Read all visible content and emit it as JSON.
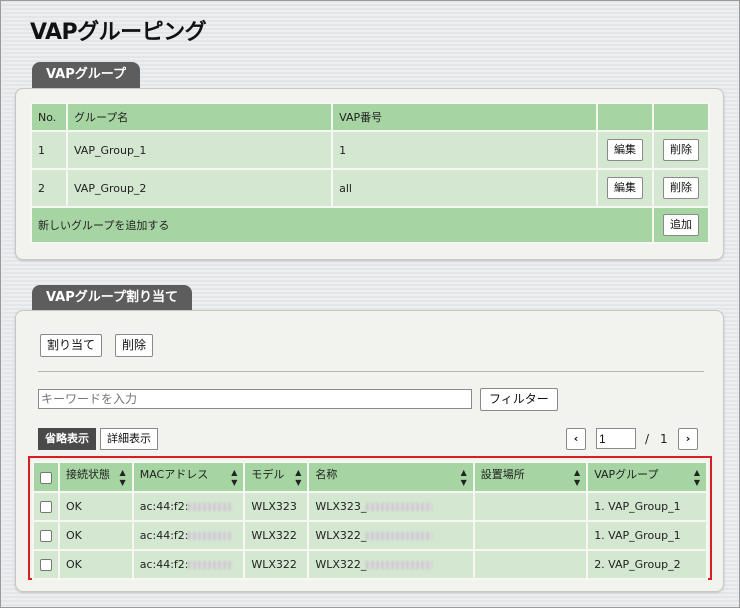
{
  "page": {
    "title": "VAPグルーピング"
  },
  "groups_section": {
    "tab_label": "VAPグループ",
    "headers": [
      "No.",
      "グループ名",
      "VAP番号"
    ],
    "rows": [
      {
        "no": "1",
        "name": "VAP_Group_1",
        "vap": "1",
        "edit_label": "編集",
        "delete_label": "削除"
      },
      {
        "no": "2",
        "name": "VAP_Group_2",
        "vap": "all",
        "edit_label": "編集",
        "delete_label": "削除"
      }
    ],
    "add_row_label": "新しいグループを追加する",
    "add_button": "追加"
  },
  "assign_section": {
    "tab_label": "VAPグループ割り当て",
    "assign_button": "割り当て",
    "delete_button": "削除",
    "keyword_placeholder": "キーワードを入力",
    "filter_button": "フィルター",
    "view_tabs": {
      "simple": "省略表示",
      "detail": "詳細表示"
    },
    "pagination": {
      "prev": "‹",
      "current": "1",
      "separator": "/",
      "total": "1",
      "next": "›"
    },
    "table_headers": [
      "接続状態",
      "MACアドレス",
      "モデル",
      "名称",
      "設置場所",
      "VAPグループ"
    ],
    "rows": [
      {
        "status": "OK",
        "mac": "ac:44:f2:",
        "model": "WLX323",
        "name": "WLX323_",
        "location": "",
        "group": "1. VAP_Group_1"
      },
      {
        "status": "OK",
        "mac": "ac:44:f2:",
        "model": "WLX322",
        "name": "WLX322_",
        "location": "",
        "group": "1. VAP_Group_1"
      },
      {
        "status": "OK",
        "mac": "ac:44:f2:",
        "model": "WLX322",
        "name": "WLX322_",
        "location": "",
        "group": "2. VAP_Group_2"
      }
    ]
  },
  "colors": {
    "header_green": "#a6d4a2",
    "row_green": "#d3e7d1",
    "tab_gray": "#5d5d5d",
    "highlight_red": "#d81e1e"
  }
}
